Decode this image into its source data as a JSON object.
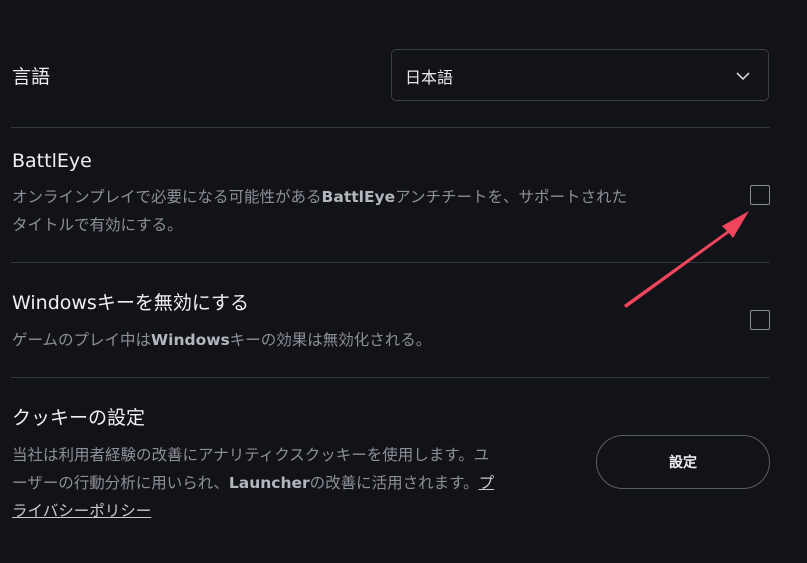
{
  "language": {
    "label": "言語",
    "selected": "日本語"
  },
  "battleye": {
    "title": "BattlEye",
    "desc_line1_prefix": "オンラインプレイで必要になる可能性がある",
    "desc_line1_strong": "BattlEye",
    "desc_line1_suffix": "アンチチートを、サポートされた",
    "desc_line2": "タイトルで有効にする。",
    "checked": false
  },
  "windows_key": {
    "title": "Windowsキーを無効にする",
    "desc_prefix": "ゲームのプレイ中は",
    "desc_strong": "Windows",
    "desc_suffix": "キーの効果は無効化される。",
    "checked": false
  },
  "cookies": {
    "title": "クッキーの設定",
    "desc_line1": "当社は利用者経験の改善にアナリティクスクッキーを使用します。ユ",
    "desc_line2_prefix": "ーザーの行動分析に用いられ、",
    "desc_line2_strong": "Launcher",
    "desc_line2_suffix": "の改善に活用されます。",
    "link_part1": "プ",
    "link_part2": "ライバシーポリシー",
    "button_label": "設定"
  },
  "colors": {
    "background": "#121318",
    "annotation_arrow": "#f0455a",
    "divider": "#34363d",
    "muted_text": "#8d8f97"
  },
  "icons": {
    "select_chevron": "chevron-down-icon",
    "annotation": "arrow-annotation"
  }
}
